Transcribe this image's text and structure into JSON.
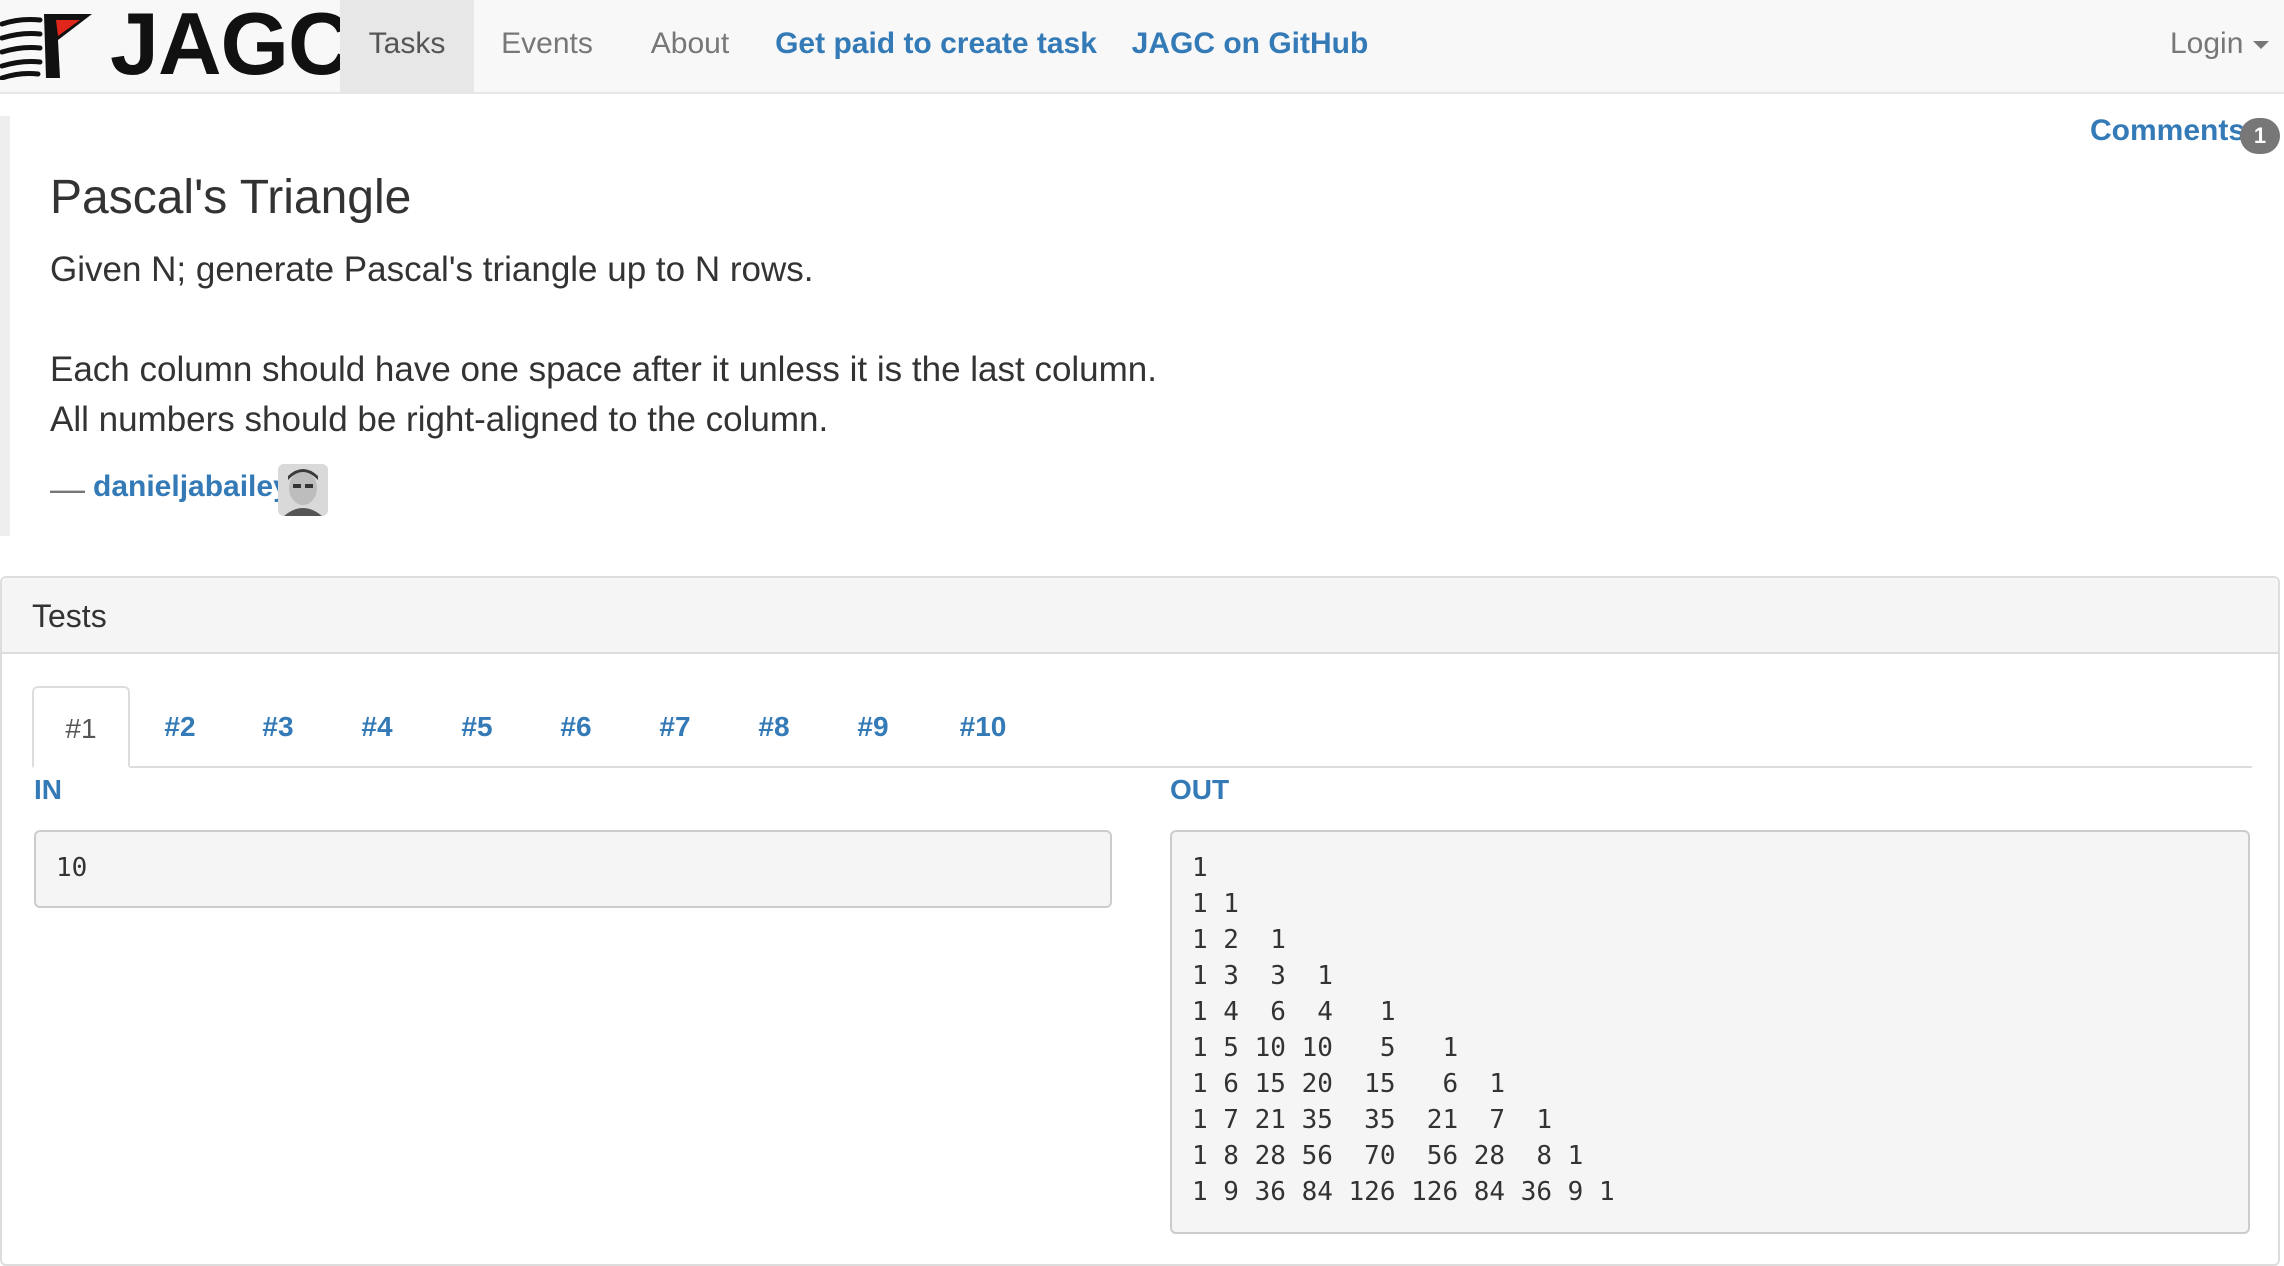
{
  "brand": {
    "name": "JAGC"
  },
  "nav": {
    "items": [
      {
        "label": "Tasks"
      },
      {
        "label": "Events"
      },
      {
        "label": "About"
      },
      {
        "label": "Get paid to create task"
      },
      {
        "label": "JAGC on GitHub"
      }
    ],
    "login": "Login"
  },
  "task": {
    "comments_label": "Comments",
    "comments_count": "1",
    "title": "Pascal's Triangle",
    "description": [
      "Given N; generate Pascal's triangle up to N rows.",
      "Each column should have one space after it unless it is the last column.",
      "All numbers should be right-aligned to the column."
    ],
    "author_dash": "—",
    "author": "danieljabailey"
  },
  "tests": {
    "heading": "Tests",
    "tabs": [
      "#1",
      "#2",
      "#3",
      "#4",
      "#5",
      "#6",
      "#7",
      "#8",
      "#9",
      "#10"
    ],
    "in_label": "IN",
    "out_label": "OUT",
    "input": "10",
    "output": "1\n1 1\n1 2  1\n1 3  3  1\n1 4  6  4   1\n1 5 10 10   5   1\n1 6 15 20  15   6  1\n1 7 21 35  35  21  7  1\n1 8 28 56  70  56 28  8 1\n1 9 36 84 126 126 84 36 9 1"
  },
  "colors": {
    "link": "#337ab7",
    "nav_bg": "#f8f8f8",
    "active_nav_bg": "#e7e7e7",
    "badge_bg": "#777777"
  }
}
